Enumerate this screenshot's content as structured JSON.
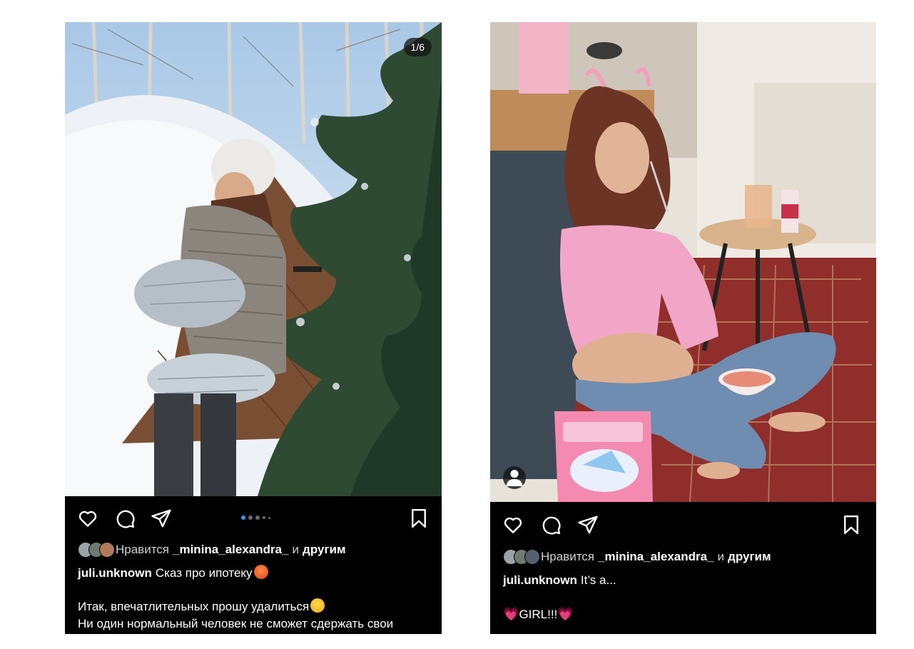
{
  "posts": [
    {
      "slide_counter": "1/6",
      "carousel": {
        "total": 5,
        "active_index": 0
      },
      "likes": {
        "prefix": "Нравится",
        "user": "_minina_alexandra_",
        "and": "и",
        "others": "другим"
      },
      "caption": {
        "username": "juli.unknown",
        "text": "Сказ про ипотеку",
        "emoji": "rage-face",
        "line2": "Итак, впечатлительных прошу удалиться",
        "line2_emoji": "laughing-face",
        "line3": "Ни один нормальный человек не сможет сдержать свои"
      }
    },
    {
      "likes": {
        "prefix": "Нравится",
        "user": "_minina_alexandra_",
        "and": "и",
        "others": "другим"
      },
      "caption": {
        "username": "juli.unknown",
        "text": "It’s a...",
        "line2": "GIRL!!!",
        "heart_emoji": "💗"
      }
    }
  ],
  "colors": {
    "background": "#ffffff",
    "post_bg": "#000000",
    "accent": "#3897f0"
  }
}
